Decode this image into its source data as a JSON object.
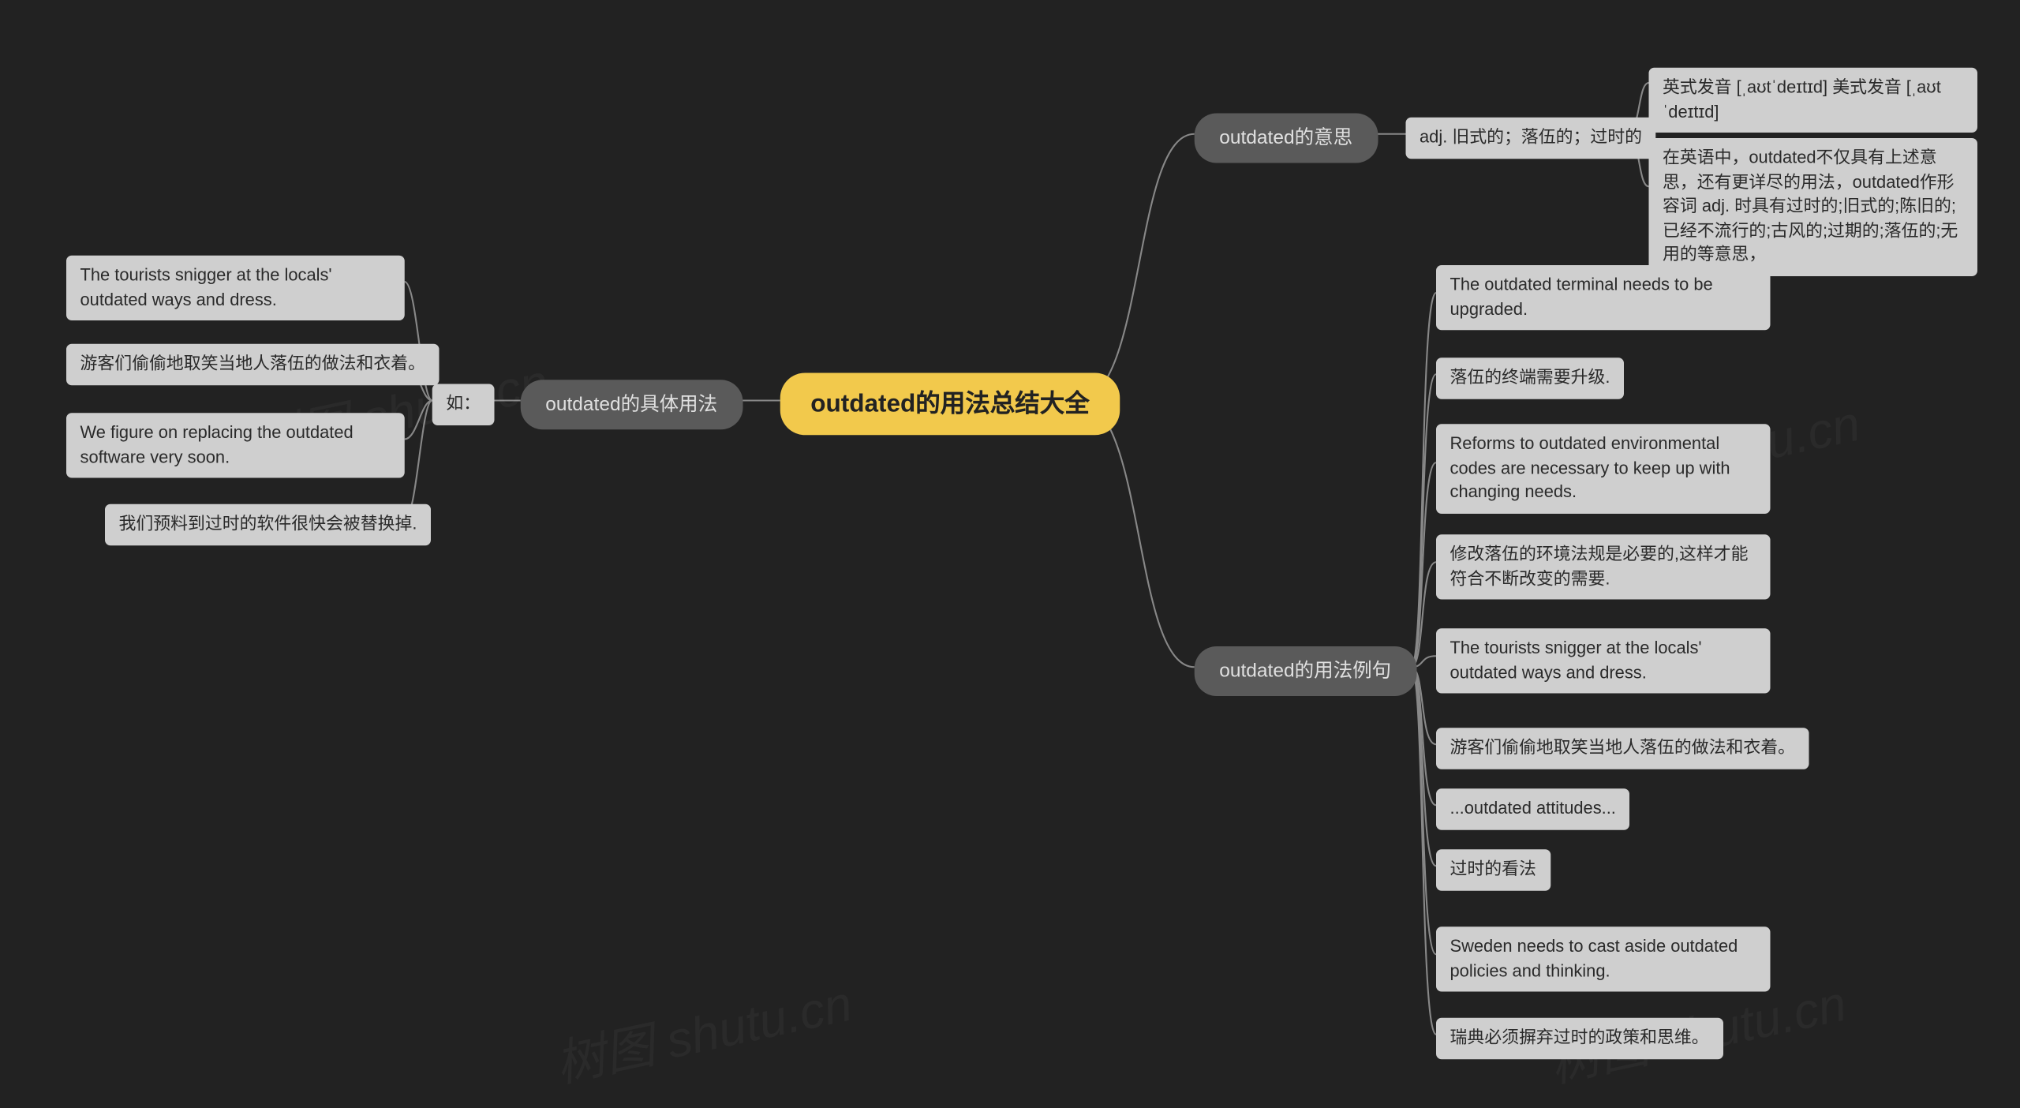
{
  "root": "outdated的用法总结大全",
  "branches": {
    "meaning": "outdated的意思",
    "usage": "outdated的具体用法",
    "examples": "outdated的用法例句"
  },
  "meaning": {
    "def": "adj. 旧式的；落伍的；过时的",
    "pron": "英式发音 [ˌaʊtˈdeɪtɪd] 美式发音 [ˌaʊtˈdeɪtɪd]",
    "note": "在英语中，outdated不仅具有上述意思，还有更详尽的用法，outdated作形容词 adj. 时具有过时的;旧式的;陈旧的;已经不流行的;古风的;过期的;落伍的;无用的等意思，"
  },
  "usage": {
    "lead": "如：",
    "items": [
      "The tourists snigger at the locals' outdated ways and dress.",
      "游客们偷偷地取笑当地人落伍的做法和衣着。",
      "We figure on replacing the outdated software very soon.",
      "我们预料到过时的软件很快会被替换掉."
    ]
  },
  "examples": [
    "The outdated terminal needs to be upgraded.",
    "落伍的终端需要升级.",
    "Reforms to outdated environmental codes are necessary to keep up with changing needs.",
    "修改落伍的环境法规是必要的,这样才能符合不断改变的需要.",
    "The tourists snigger at the locals' outdated ways and dress.",
    "游客们偷偷地取笑当地人落伍的做法和衣着。",
    "...outdated attitudes...",
    "过时的看法",
    "Sweden needs to cast aside outdated policies and thinking.",
    "瑞典必须摒弃过时的政策和思维。"
  ],
  "watermark": "树图 shutu.cn"
}
